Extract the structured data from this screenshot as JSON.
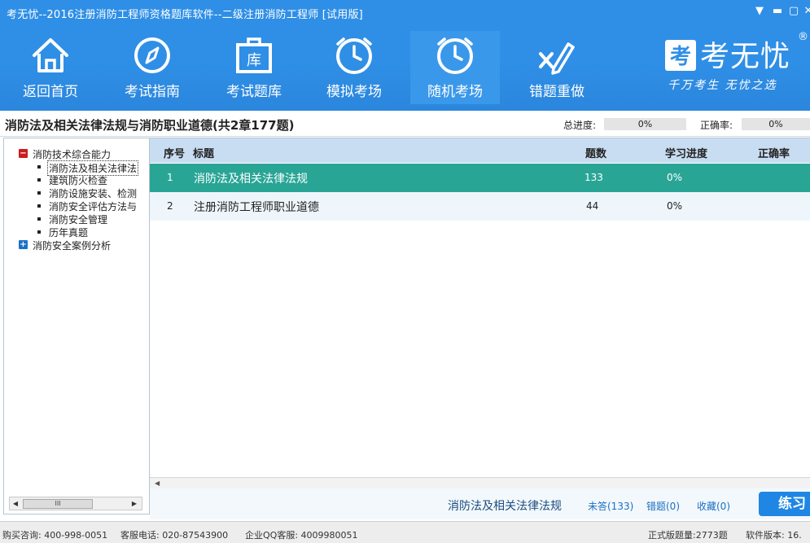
{
  "window": {
    "title": "考无忧--2016注册消防工程师资格题库软件--二级注册消防工程师 [试用版]",
    "controls": [
      "▼",
      "▬",
      "▢",
      "✕"
    ]
  },
  "nav": [
    {
      "label": "返回首页",
      "icon": "home-icon"
    },
    {
      "label": "考试指南",
      "icon": "compass-icon"
    },
    {
      "label": "考试题库",
      "icon": "question-bank-icon",
      "icon_text": "库"
    },
    {
      "label": "模拟考场",
      "icon": "clock-icon"
    },
    {
      "label": "随机考场",
      "icon": "clock-icon"
    },
    {
      "label": "错题重做",
      "icon": "redo-mistakes-icon"
    }
  ],
  "brand": {
    "logo_char": "考",
    "name": "考无忧",
    "registered": "®",
    "slogan": "千万考生  无忧之选"
  },
  "subject": {
    "title": "消防法及相关法律法规与消防职业道德(共2章177题)",
    "total_progress_label": "总进度:",
    "total_progress_value": "0%",
    "accuracy_label": "正确率:",
    "accuracy_value": "0%"
  },
  "tree": {
    "groups": [
      {
        "label": "消防技术综合能力",
        "expanded": true,
        "children": [
          "消防法及相关法律法",
          "建筑防火检查",
          "消防设施安装、检测",
          "消防安全评估方法与",
          "消防安全管理",
          "历年真题"
        ]
      },
      {
        "label": "消防安全案例分析",
        "expanded": false,
        "children": []
      }
    ],
    "scroll_thumb": "III"
  },
  "table": {
    "headers": [
      "序号",
      "标题",
      "题数",
      "学习进度",
      "正确率"
    ],
    "rows": [
      {
        "no": "1",
        "title": "消防法及相关法律法规",
        "count": "133",
        "progress": "0%",
        "accuracy": ""
      },
      {
        "no": "2",
        "title": "注册消防工程师职业道德",
        "count": "44",
        "progress": "0%",
        "accuracy": ""
      }
    ]
  },
  "actions": {
    "selected_chapter": "消防法及相关法律法规",
    "unanswered": "未答(133)",
    "wrong": "错题(0)",
    "favorites": "收藏(0)",
    "practice": "练习"
  },
  "status": {
    "purchase": "购买咨询: 400-998-0051",
    "service_phone": "客服电话: 020-87543900",
    "qq": "企业QQ客服: 4009980051",
    "official_count": "正式版题量:2773题",
    "version": "软件版本: 16."
  },
  "colors": {
    "header_blue": "#2f8fe6",
    "selected_row": "#29a596",
    "table_header": "#c8ddf1",
    "link_blue": "#1b6fc2"
  }
}
